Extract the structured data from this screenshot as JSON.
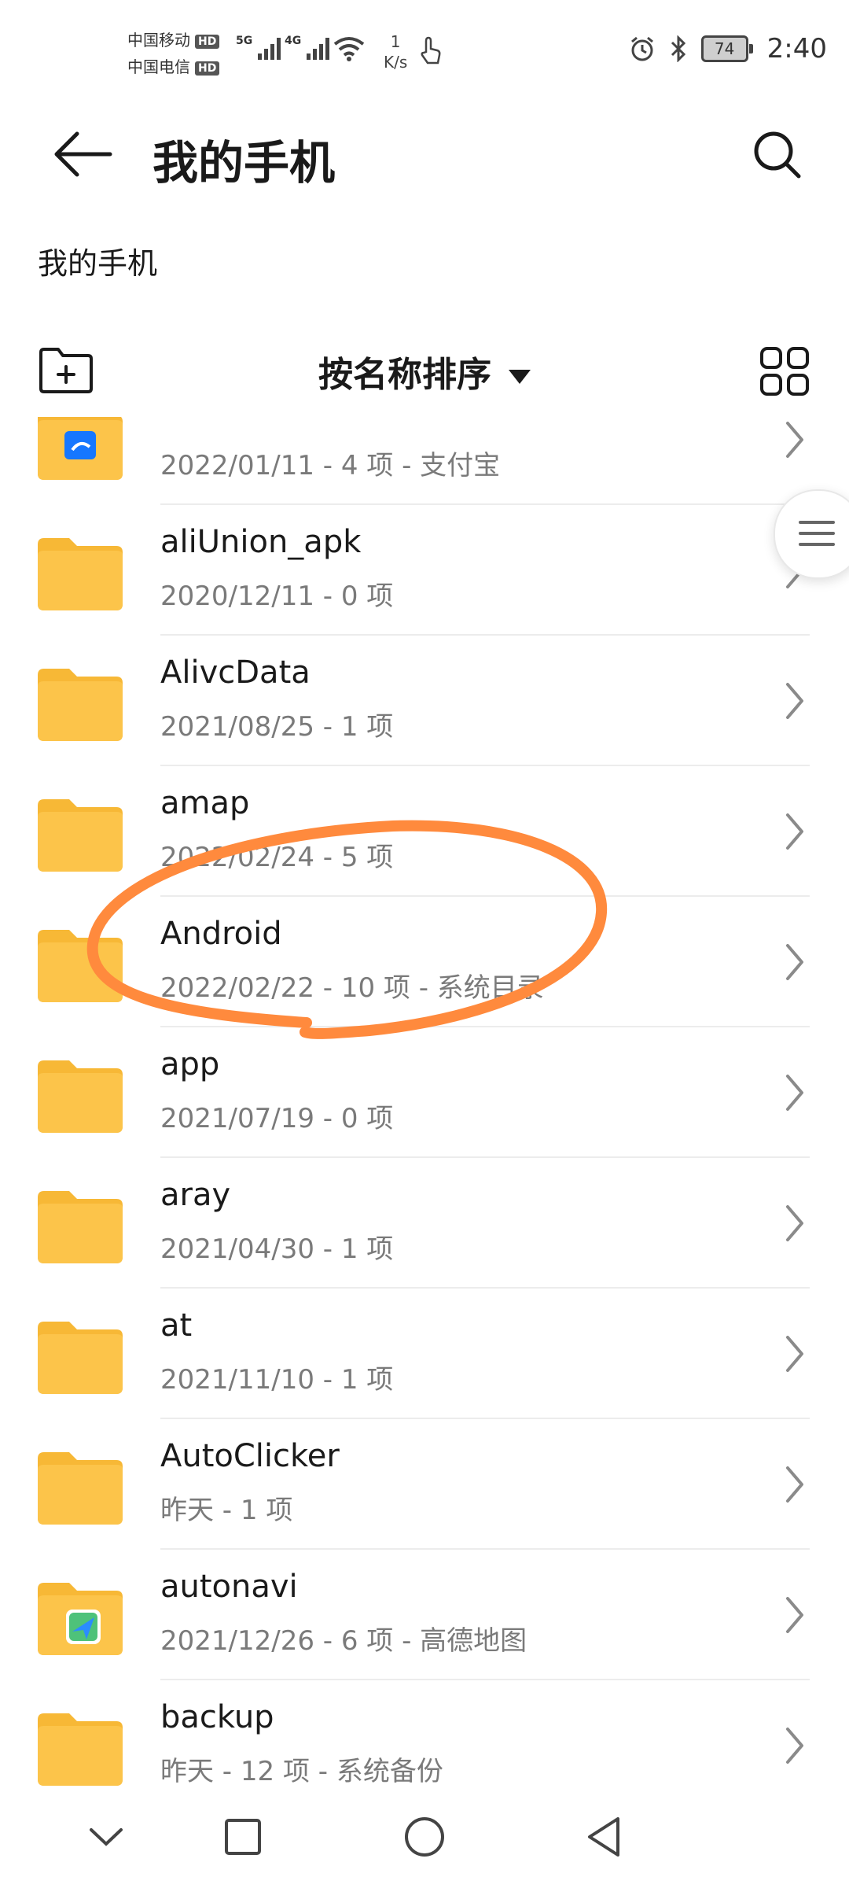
{
  "status_bar": {
    "carrier1": "中国移动",
    "carrier2": "中国电信",
    "hd_label": "HD",
    "net1": "5G",
    "net2": "4G",
    "speed_value": "1",
    "speed_unit": "K/s",
    "battery": "74",
    "time": "2:40"
  },
  "header": {
    "title": "我的手机"
  },
  "breadcrumb": "我的手机",
  "toolbar": {
    "sort_label": "按名称排序"
  },
  "files": [
    {
      "name": "",
      "meta": "2022/01/11 - 4 项 - 支付宝",
      "icon": "alipay-folder-icon"
    },
    {
      "name": "aliUnion_apk",
      "meta": "2020/12/11 - 0 项",
      "icon": "folder-icon"
    },
    {
      "name": "AlivcData",
      "meta": "2021/08/25 - 1 项",
      "icon": "folder-icon"
    },
    {
      "name": "amap",
      "meta": "2022/02/24 - 5 项",
      "icon": "folder-icon"
    },
    {
      "name": "Android",
      "meta": "2022/02/22 - 10 项 - 系统目录",
      "icon": "folder-icon"
    },
    {
      "name": "app",
      "meta": "2021/07/19 - 0 项",
      "icon": "folder-icon"
    },
    {
      "name": "aray",
      "meta": "2021/04/30 - 1 项",
      "icon": "folder-icon"
    },
    {
      "name": "at",
      "meta": "2021/11/10 - 1 项",
      "icon": "folder-icon"
    },
    {
      "name": "AutoClicker",
      "meta": "昨天 - 1 项",
      "icon": "folder-icon"
    },
    {
      "name": "autonavi",
      "meta": "2021/12/26 - 6 项 - 高德地图",
      "icon": "amap-folder-icon"
    },
    {
      "name": "backup",
      "meta": "昨天 - 12 项 - 系统备份",
      "icon": "folder-icon"
    }
  ],
  "colors": {
    "folder": "#fcc44a",
    "folder_tab": "#f7b836",
    "annotation": "#ff8a3d",
    "meta_text": "#7a7a7a"
  }
}
